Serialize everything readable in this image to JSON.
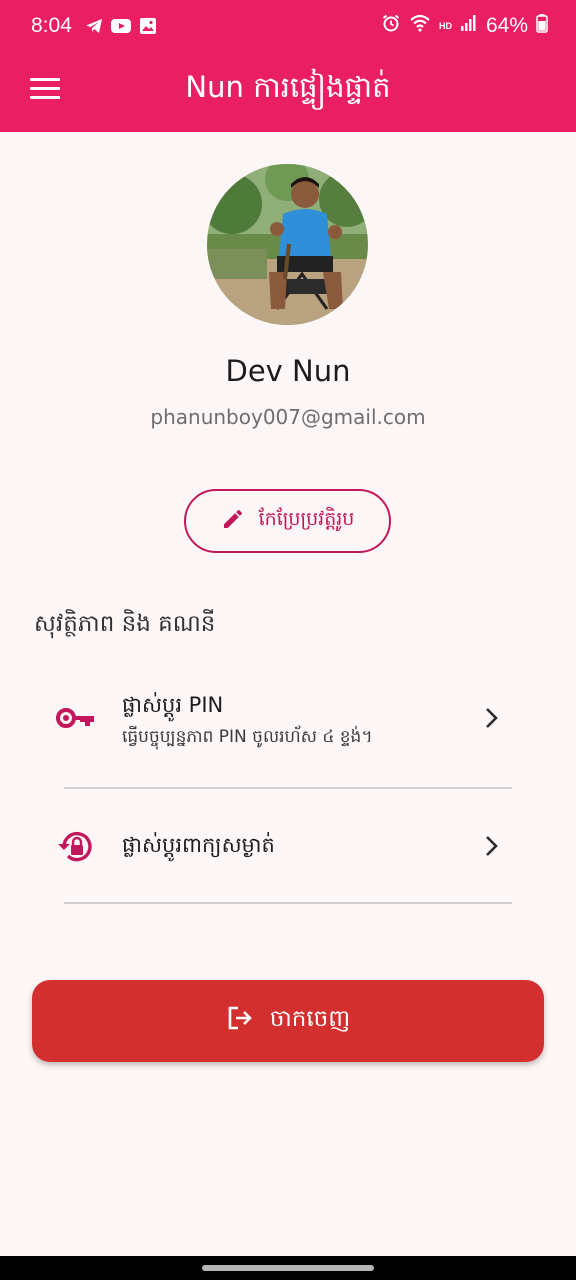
{
  "status_bar": {
    "time": "8:04",
    "hd": "HD",
    "battery": "64%",
    "left_icons": [
      "telegram-icon",
      "youtube-icon",
      "gallery-icon"
    ],
    "right_icons": [
      "alarm-icon",
      "wifi-icon",
      "signal-icon",
      "battery-icon"
    ]
  },
  "app_bar": {
    "title": "Nun ការផ្ទៀងផ្ទាត់",
    "color": "#e91e63"
  },
  "profile": {
    "name": "Dev Nun",
    "email": "phanunboy007@gmail.com",
    "edit_label": "កែប្រែប្រវត្តិរូប",
    "accent": "#c2185b"
  },
  "security": {
    "section_title": "សុវត្ថិភាព និង គណនី",
    "items": [
      {
        "title": "ផ្លាស់ប្តូរ PIN",
        "subtitle": "ធ្វើបច្ចុប្បន្នភាព PIN ចូលរហ័ស ៤ ខ្ទង់។",
        "icon": "key-icon"
      },
      {
        "title": "ផ្លាស់ប្តូរពាក្យសម្ងាត់",
        "icon": "lock-reset-icon"
      }
    ]
  },
  "logout": {
    "label": "ចាកចេញ",
    "color": "#d32f2f",
    "icon": "logout-icon"
  }
}
